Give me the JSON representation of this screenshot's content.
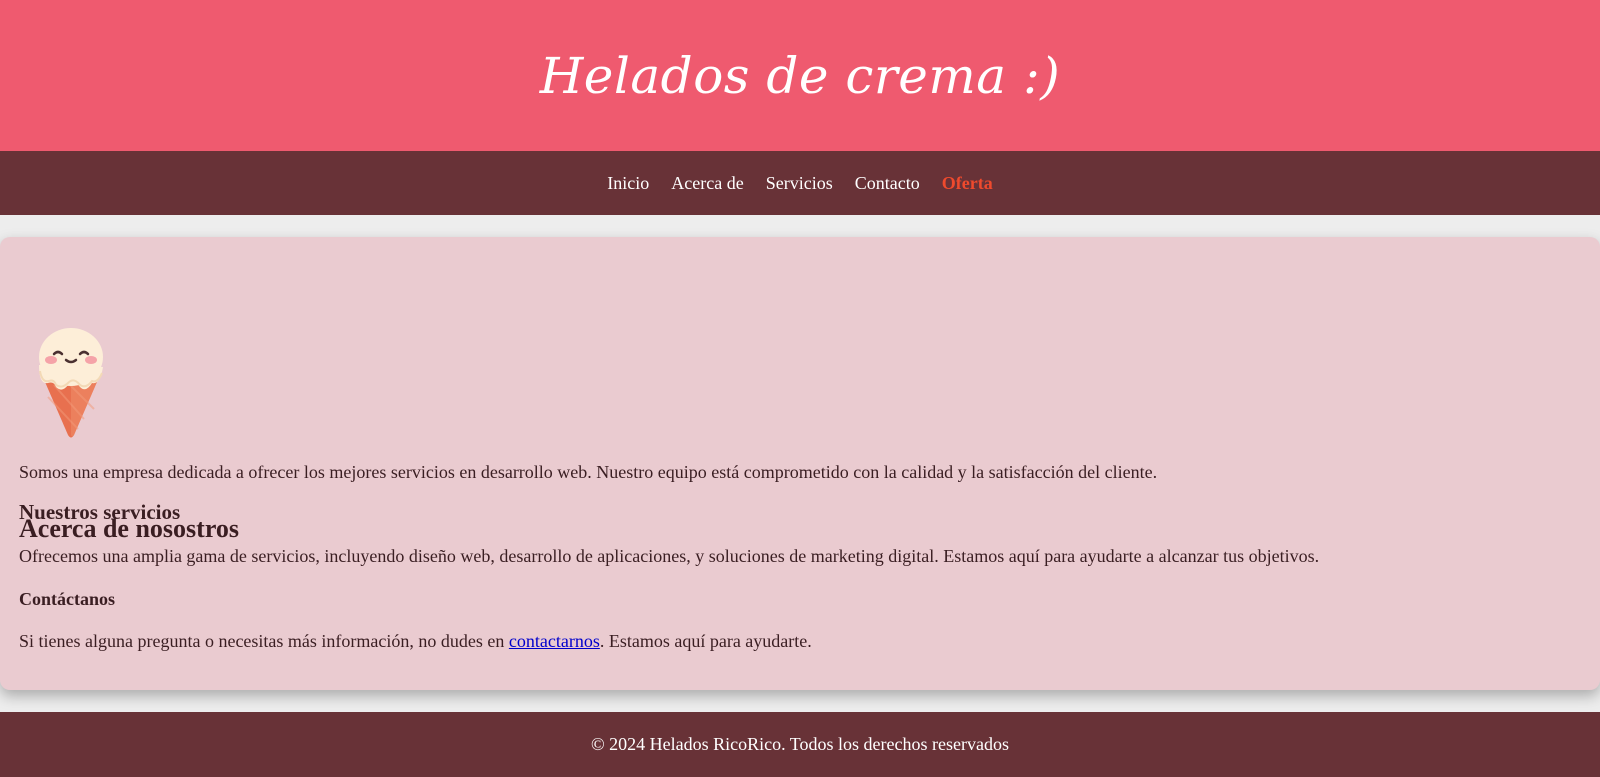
{
  "header": {
    "title": "Helados de crema :)"
  },
  "nav": {
    "items": [
      {
        "label": "Inicio"
      },
      {
        "label": "Acerca de"
      },
      {
        "label": "Servicios"
      },
      {
        "label": "Contacto"
      },
      {
        "label": "Oferta"
      }
    ]
  },
  "main": {
    "about_heading": "Acerca de nosostros",
    "mascot_icon": "ice-cream-cone-icon",
    "about_text": "Somos una empresa dedicada a ofrecer los mejores servicios en desarrollo web. Nuestro equipo está comprometido con la calidad y la satisfacción del cliente.",
    "services_heading": "Nuestros servicios",
    "services_text": "Ofrecemos una amplia gama de servicios, incluyendo diseño web, desarrollo de aplicaciones, y soluciones de marketing digital. Estamos aquí para ayudarte a alcanzar tus objetivos.",
    "contact_heading": "Contáctanos",
    "contact_text_before": "Si tienes alguna pregunta o necesitas más información, no dudes en ",
    "contact_link": "contactarnos",
    "contact_text_after": ". Estamos aquí para ayudarte."
  },
  "footer": {
    "text": "© 2024 Helados RicoRico. Todos los derechos reservados"
  },
  "colors": {
    "header_bg": "#ef5a6f",
    "nav_bg": "#683237",
    "card_bg": "#eacbd0",
    "offer_accent": "#ef4a2d",
    "link": "#0000cc"
  }
}
